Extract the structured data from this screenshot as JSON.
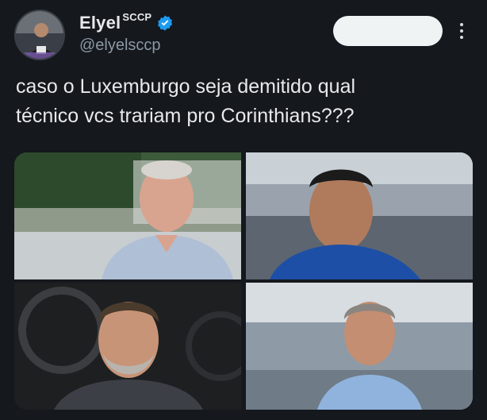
{
  "author": {
    "display_name": "Elyel",
    "name_suffix": "SCCP",
    "handle": "@elyelsccp",
    "verified": true,
    "verified_color": "#1d9bf0"
  },
  "actions": {
    "follow_label": "",
    "more_icon": "more-vertical-icon"
  },
  "tweet": {
    "text": "caso o Luxemburgo seja demitido qual\ntécnico vcs trariam pro Corinthians???"
  },
  "media": {
    "count": 4
  },
  "colors": {
    "background": "#15181c",
    "text": "#e7e9ea",
    "secondary_text": "#8b98a5",
    "follow_button": "#eff3f4"
  }
}
